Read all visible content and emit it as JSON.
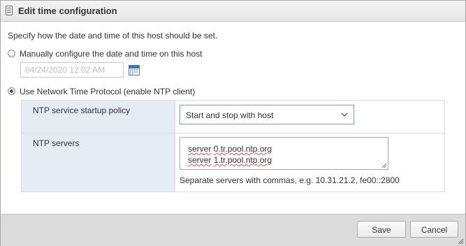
{
  "dialog": {
    "title": "Edit time configuration",
    "intro": "Specify how the date and time of this host should be set."
  },
  "manual": {
    "label": "Manually configure the date and time on this host",
    "selected": false,
    "date_value": "04/24/2020 12:02 AM"
  },
  "ntp": {
    "label": "Use Network Time Protocol (enable NTP client)",
    "selected": true,
    "policy_label": "NTP service startup policy",
    "policy_value": "Start and stop with host",
    "servers_label": "NTP servers",
    "servers": [
      {
        "prefix": "server",
        "host": "0.tr.pool.ntp.org"
      },
      {
        "prefix": "server",
        "host": "1.tr.pool.ntp.org"
      }
    ],
    "help_text": "Separate servers with commas, e.g. 10.31.21.2, fe00::2800"
  },
  "footer": {
    "save_label": "Save",
    "cancel_label": "Cancel"
  },
  "colors": {
    "label_column_bg": "#e4ecf4",
    "footer_bg": "#dcdcdc",
    "select_border": "#7fa6cf",
    "spell_underline": "#d9534f"
  },
  "icons": {
    "title": "host-icon",
    "calendar": "calendar-icon",
    "dropdown": "chevron-down-icon"
  }
}
